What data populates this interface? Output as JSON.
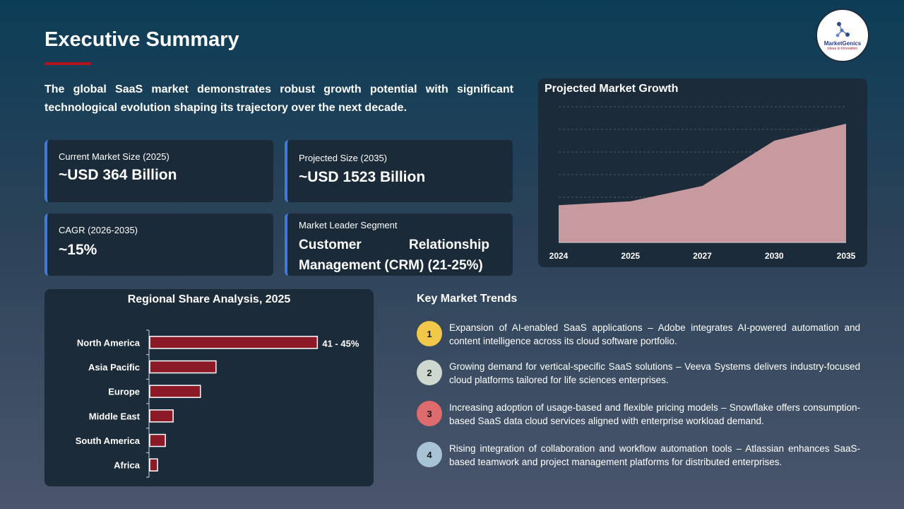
{
  "header": {
    "title": "Executive Summary",
    "intro": "The global SaaS market demonstrates robust growth potential with significant technological evolution shaping its trajectory over the next decade."
  },
  "logo": {
    "name": "MarketGenics",
    "tagline": "Ideas to Innovation"
  },
  "cards": {
    "current_label": "Current Market Size (2025)",
    "current_value": "~USD 364 Billion",
    "projected_label": "Projected Size (2035)",
    "projected_value": "~USD 1523 Billion",
    "cagr_label": "CAGR (2026-2035)",
    "cagr_value": "~15%",
    "leader_label": "Market Leader Segment",
    "leader_value": "Customer Relationship Management (CRM) (21-25%)"
  },
  "colors": {
    "accent_blue": "#3f7bd4",
    "area_fill": "#c79a9f",
    "bar_fill": "#8b1a26",
    "underline_red": "#b0121e"
  },
  "chart_data": [
    {
      "type": "area",
      "title": "Projected Market Growth",
      "x": [
        "2024",
        "2025",
        "2027",
        "2030",
        "2035"
      ],
      "values": [
        330,
        364,
        500,
        900,
        1050
      ],
      "ylim": [
        0,
        1200
      ],
      "grid": true
    },
    {
      "type": "bar",
      "orientation": "horizontal",
      "title": "Regional Share Analysis, 2025",
      "categories": [
        "North America",
        "Asia Pacific",
        "Europe",
        "Middle East",
        "South America",
        "Africa"
      ],
      "values": [
        43,
        17,
        13,
        6,
        4,
        2
      ],
      "data_labels": [
        "41 - 45%",
        "",
        "",
        "",
        "",
        ""
      ],
      "xlim": [
        0,
        50
      ]
    }
  ],
  "trends": {
    "title": "Key Market Trends",
    "items": [
      {
        "num": "1",
        "color": "#f2c84b",
        "text": "Expansion of AI-enabled SaaS applications – Adobe integrates AI-powered automation and content intelligence across its cloud software portfolio."
      },
      {
        "num": "2",
        "color": "#cfd8cf",
        "text": "Growing demand for vertical-specific SaaS solutions – Veeva Systems delivers industry-focused cloud platforms tailored for life sciences enterprises."
      },
      {
        "num": "3",
        "color": "#de6b6e",
        "text": "Increasing adoption of usage-based and flexible pricing models – Snowflake offers consumption-based SaaS data cloud services aligned with enterprise workload demand."
      },
      {
        "num": "4",
        "color": "#a8c2d6",
        "text": "Rising integration of collaboration and workflow automation tools – Atlassian enhances SaaS-based teamwork and project management platforms for distributed enterprises."
      }
    ]
  }
}
